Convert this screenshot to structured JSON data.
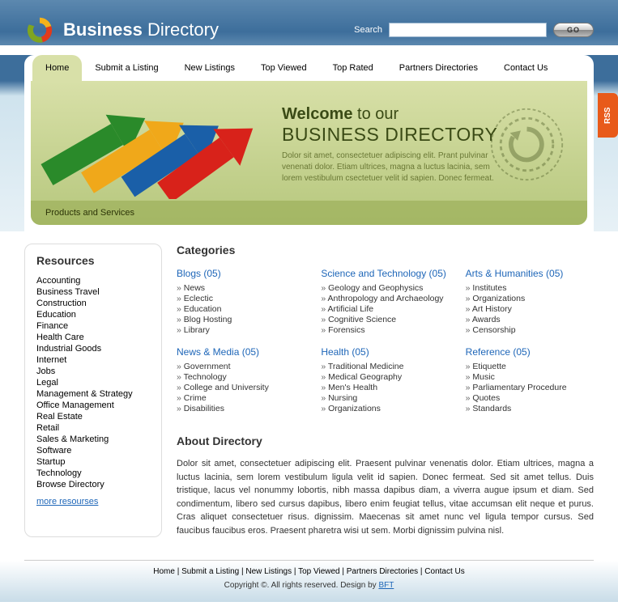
{
  "site": {
    "title_bold": "Business",
    "title_light": "Directory"
  },
  "search": {
    "label": "Search",
    "button": "GO",
    "placeholder": ""
  },
  "rss": "RSS",
  "nav": [
    {
      "label": "Home",
      "active": true
    },
    {
      "label": "Submit a Listing"
    },
    {
      "label": "New Listings"
    },
    {
      "label": "Top Viewed"
    },
    {
      "label": "Top Rated"
    },
    {
      "label": "Partners Directories"
    },
    {
      "label": "Contact Us"
    }
  ],
  "hero": {
    "welcome_bold": "Welcome",
    "welcome_rest": " to our",
    "big": "BUSINESS DIRECTORY",
    "desc": "Dolor sit amet, consectetuer adipiscing elit. Prant pulvinar venenati dolor. Etiam ultrices, magna a luctus lacinia, sem lorem vestibulum csectetuer velit id sapien. Donec fermeat.",
    "bar": "Products and Services"
  },
  "sidebar": {
    "title": "Resources",
    "items": [
      "Accounting",
      "Business Travel",
      "Construction",
      "Education",
      "Finance",
      "Health Care",
      "Industrial Goods",
      "Internet",
      "Jobs",
      "Legal",
      "Management & Strategy",
      "Office Management",
      "Real Estate",
      "Retail",
      "Sales & Marketing",
      "Software",
      "Startup",
      "Technology",
      "Browse Directory"
    ],
    "more": "more resourses"
  },
  "categories": {
    "title": "Categories",
    "blocks": [
      {
        "title": "Blogs (05)",
        "items": [
          "News",
          "Eclectic",
          "Education",
          "Blog Hosting",
          "Library"
        ]
      },
      {
        "title": "Science and Technology (05)",
        "items": [
          "Geology and Geophysics",
          "Anthropology and Archaeology",
          "Artificial Life",
          "Cognitive Science",
          "Forensics"
        ]
      },
      {
        "title": "Arts & Humanities (05)",
        "items": [
          "Institutes",
          "Organizations",
          "Art History",
          "Awards",
          "Censorship"
        ]
      },
      {
        "title": "News & Media (05)",
        "items": [
          "Government",
          "Technology",
          "College and University",
          "Crime",
          "Disabilities"
        ]
      },
      {
        "title": "Health (05)",
        "items": [
          "Traditional Medicine",
          "Medical Geography",
          "Men's Health",
          "Nursing",
          "Organizations"
        ]
      },
      {
        "title": "Reference (05)",
        "items": [
          "Etiquette",
          "Music",
          "Parliamentary Procedure",
          "Quotes",
          "Standards"
        ]
      }
    ]
  },
  "about": {
    "title": "About Directory",
    "text": "Dolor sit amet, consectetuer adipiscing elit. Praesent pulvinar venenatis dolor. Etiam ultrices, magna a luctus lacinia, sem lorem vestibulum ligula velit id sapien. Donec fermeat. Sed sit amet tellus. Duis tristique, lacus vel nonummy lobortis, nibh massa dapibus diam, a viverra augue ipsum et diam. Sed condimentum, libero sed cursus dapibus, libero enim feugiat tellus, vitae accumsan elit neque et purus. Cras aliquet consectetuer risus. dignissim. Maecenas sit amet nunc vel ligula tempor cursus. Sed faucibus faucibus eros. Praesent pharetra wisi ut sem. Morbi dignissim pulvina nisl."
  },
  "footer": {
    "links": [
      "Home",
      "Submit a Listing",
      "New Listings",
      "Top Viewed",
      "Partners Directories",
      "Contact Us"
    ],
    "copy_pre": "Copyright ©. All rights reserved. Design by ",
    "copy_link": "BFT"
  }
}
